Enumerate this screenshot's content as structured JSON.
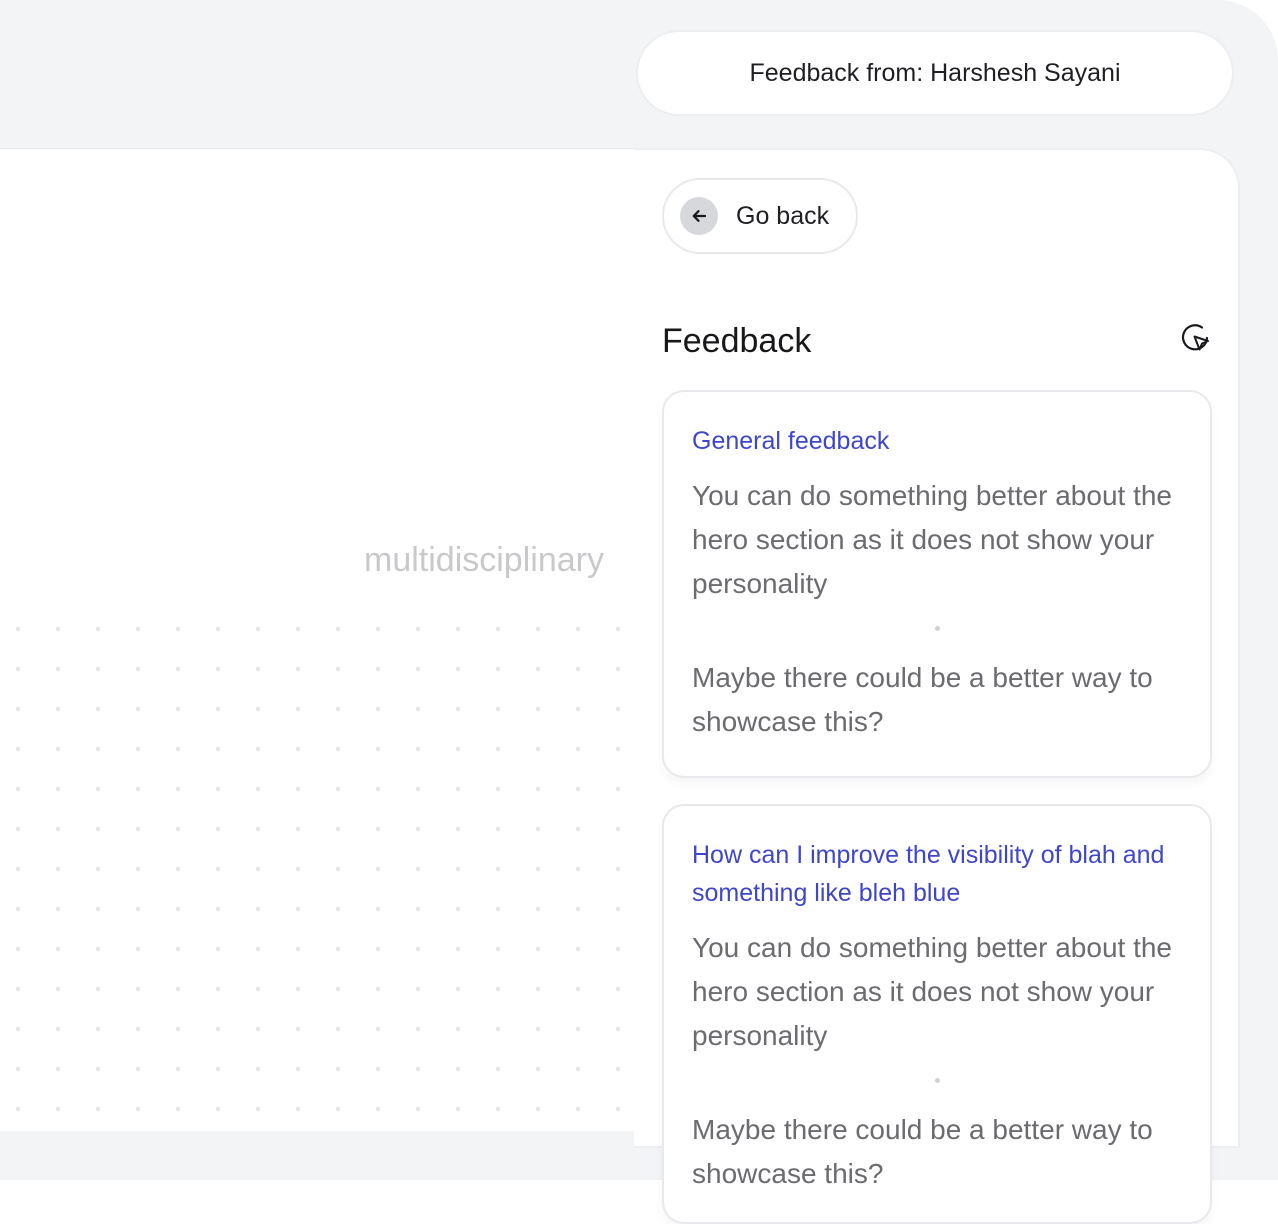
{
  "header": {
    "title": "Feedback from: Harshesh Sayani"
  },
  "canvas": {
    "word": "multidisciplinary"
  },
  "panel": {
    "back_label": "Go back",
    "title": "Feedback",
    "icons": {
      "back": "arrow-left-icon",
      "refresh": "refresh-cursor-icon"
    },
    "cards": [
      {
        "question": "General feedback",
        "paragraphs": [
          "You can do something better about the hero section as it does not show your personality",
          "Maybe there could be a better way to showcase this?"
        ]
      },
      {
        "question": "How can I improve the visibility of blah and something like bleh blue",
        "paragraphs": [
          "You can do something better about the hero section as it does not show your personality",
          "Maybe there could be a better way to showcase this?"
        ]
      }
    ]
  },
  "colors": {
    "accent": "#3f46c9",
    "text_muted": "#6b6b70",
    "background": "#f3f4f6"
  }
}
